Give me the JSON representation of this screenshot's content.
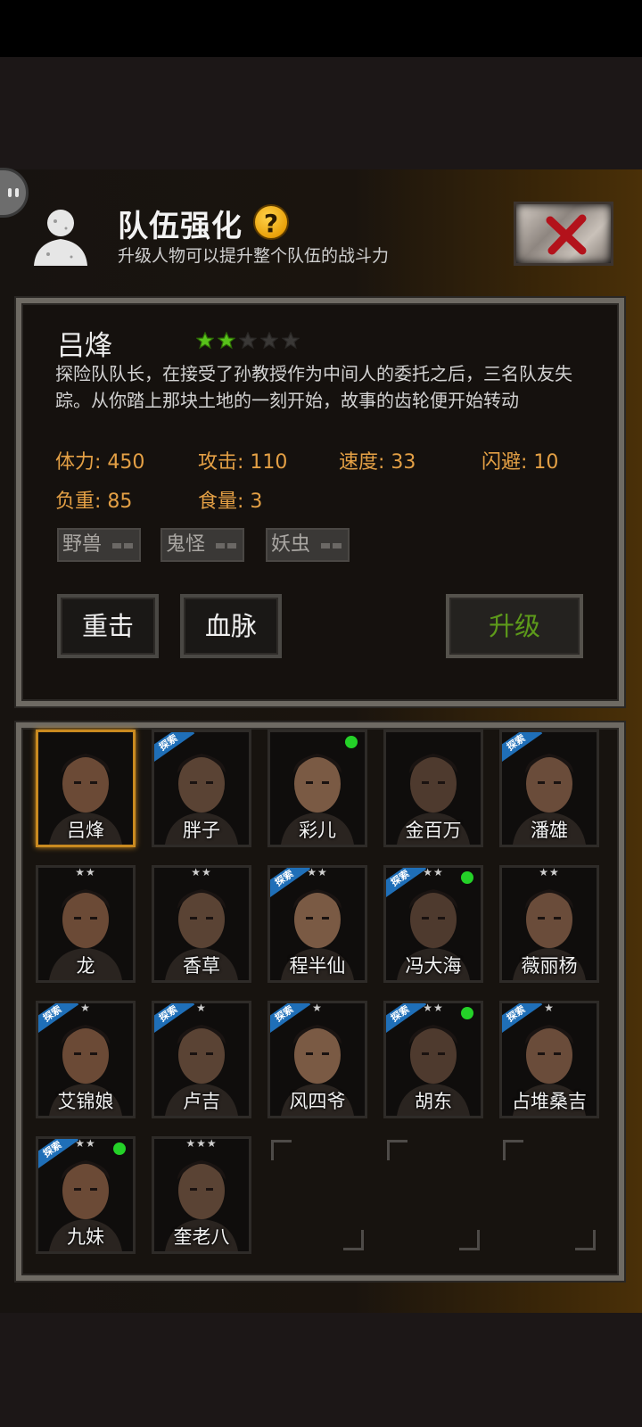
{
  "dialog": {
    "title": "队伍强化",
    "subtitle": "升级人物可以提升整个队伍的战斗力",
    "help_label": "?"
  },
  "character": {
    "name": "吕烽",
    "stars_filled": 2,
    "stars_total": 5,
    "description": "探险队队长，在接受了孙教授作为中间人的委托之后，三名队友失踪。从你踏上那块土地的一刻开始，故事的齿轮便开始转动",
    "stats": {
      "hp": "体力: 450",
      "attack": "攻击: 110",
      "speed": "速度: 33",
      "evade": "闪避: 10",
      "load": "负重: 85",
      "food": "食量: 3"
    },
    "tags": [
      "野兽",
      "鬼怪",
      "妖虫"
    ],
    "skills": [
      "重击",
      "血脉"
    ],
    "upgrade_label": "升级"
  },
  "explore_badge_text": "探索",
  "roster": [
    {
      "name": "吕烽",
      "stars": 0,
      "explore": false,
      "online": false,
      "selected": true
    },
    {
      "name": "胖子",
      "stars": 0,
      "explore": true,
      "online": false,
      "selected": false
    },
    {
      "name": "彩儿",
      "stars": 0,
      "explore": false,
      "online": true,
      "selected": false
    },
    {
      "name": "金百万",
      "stars": 0,
      "explore": false,
      "online": false,
      "selected": false
    },
    {
      "name": "潘雄",
      "stars": 0,
      "explore": true,
      "online": false,
      "selected": false
    },
    {
      "name": "龙",
      "stars": 2,
      "explore": false,
      "online": false,
      "selected": false
    },
    {
      "name": "香草",
      "stars": 2,
      "explore": false,
      "online": false,
      "selected": false
    },
    {
      "name": "程半仙",
      "stars": 2,
      "explore": true,
      "online": false,
      "selected": false
    },
    {
      "name": "冯大海",
      "stars": 2,
      "explore": true,
      "online": true,
      "selected": false
    },
    {
      "name": "薇丽杨",
      "stars": 2,
      "explore": false,
      "online": false,
      "selected": false
    },
    {
      "name": "艾锦娘",
      "stars": 1,
      "explore": true,
      "online": false,
      "selected": false
    },
    {
      "name": "卢吉",
      "stars": 1,
      "explore": true,
      "online": false,
      "selected": false
    },
    {
      "name": "风四爷",
      "stars": 1,
      "explore": true,
      "online": false,
      "selected": false
    },
    {
      "name": "胡东",
      "stars": 2,
      "explore": true,
      "online": true,
      "selected": false
    },
    {
      "name": "占堆桑吉",
      "stars": 1,
      "explore": true,
      "online": false,
      "selected": false
    },
    {
      "name": "九妹",
      "stars": 2,
      "explore": true,
      "online": true,
      "selected": false
    },
    {
      "name": "奎老八",
      "stars": 3,
      "explore": false,
      "online": false,
      "selected": false
    }
  ],
  "empty_slots": 3,
  "colors": {
    "stat_orange": "#e4a045",
    "upgrade_green": "#5d9a1a",
    "star_green": "#58c21a",
    "explore_blue": "#1f6fb8",
    "online_green": "#24d128",
    "selected_gold": "#c98a20"
  }
}
